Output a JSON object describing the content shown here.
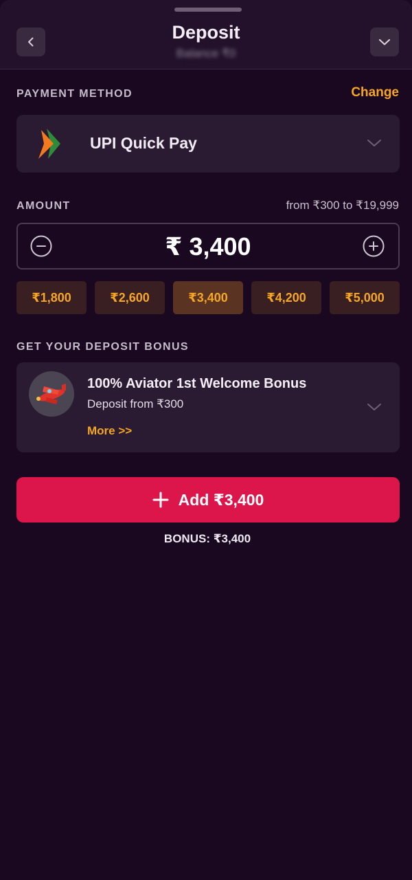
{
  "header": {
    "title": "Deposit",
    "subtitle": "Balance ₹0",
    "back_icon": "chevron-left-icon",
    "collapse_icon": "chevron-down-icon"
  },
  "payment": {
    "section_label": "PAYMENT METHOD",
    "change_label": "Change",
    "method_name": "UPI Quick Pay",
    "method_icon": "upi-logo-icon"
  },
  "amount": {
    "section_label": "AMOUNT",
    "range_text": "from ₹300 to ₹19,999",
    "value": "₹ 3,400",
    "presets": [
      "₹1,800",
      "₹2,600",
      "₹3,400",
      "₹4,200",
      "₹5,000"
    ],
    "selected_preset": "₹3,400"
  },
  "bonus": {
    "section_label": "GET YOUR DEPOSIT BONUS",
    "title": "100% Aviator 1st Welcome Bonus",
    "subtitle": "Deposit from ₹300",
    "more_label": "More >>",
    "icon": "airplane-icon"
  },
  "action": {
    "add_label": "Add ₹3,400",
    "bonus_summary": "BONUS: ₹3,400"
  },
  "colors": {
    "background": "#1a0720",
    "card": "#2a1a32",
    "accent_orange": "#f5a623",
    "primary_button": "#dc154a",
    "active_preset": "#5a3322"
  }
}
